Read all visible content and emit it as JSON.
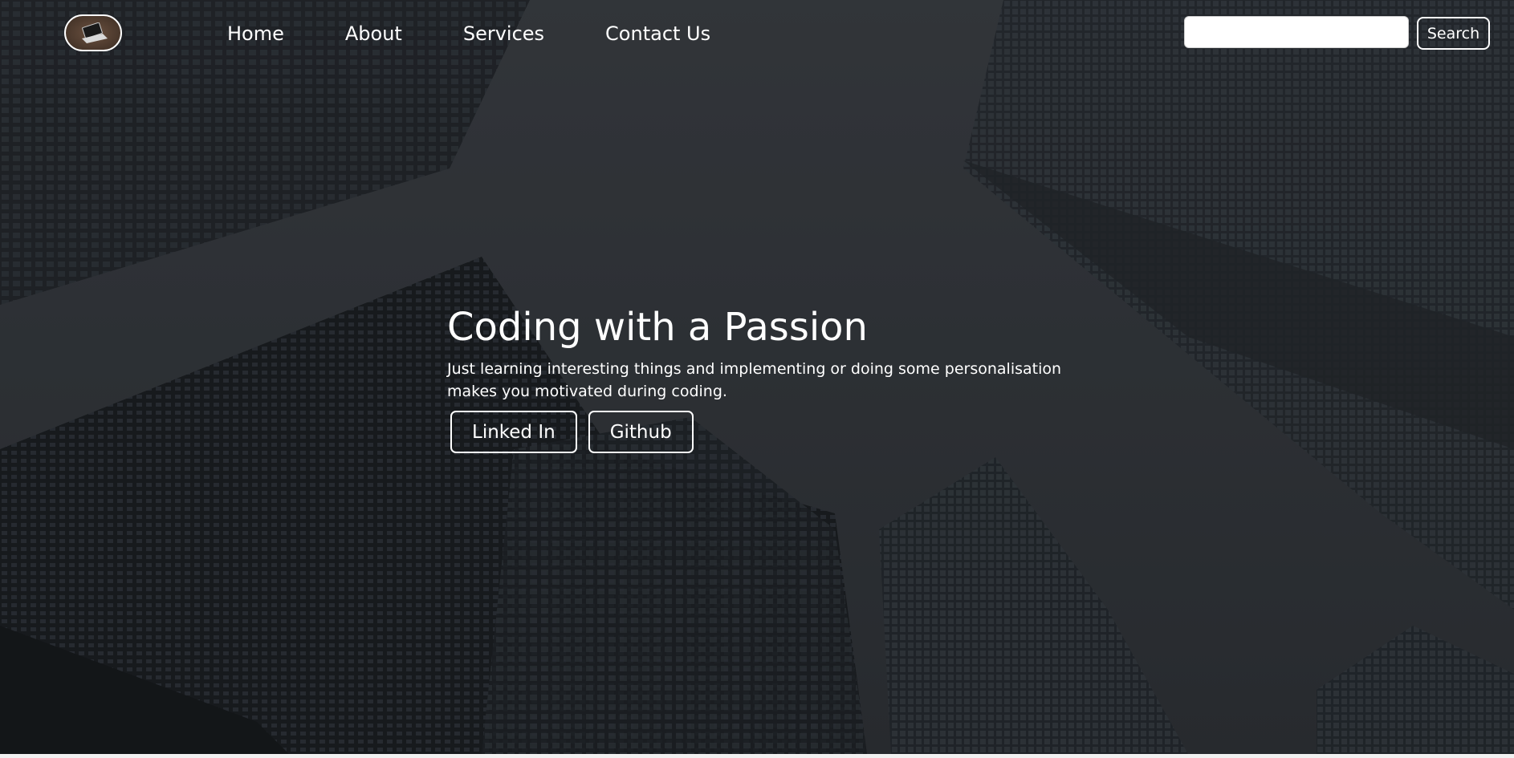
{
  "nav": {
    "logo_icon": "laptop-icon",
    "links": [
      {
        "label": "Home"
      },
      {
        "label": "About"
      },
      {
        "label": "Services"
      },
      {
        "label": "Contact Us"
      }
    ]
  },
  "search": {
    "value": "",
    "placeholder": "",
    "button_label": "Search"
  },
  "hero": {
    "title": "Coding with a Passion",
    "text": "Just learning interesting things and implementing or doing some personalisation makes you motivated during coding.",
    "buttons": [
      {
        "label": "Linked In"
      },
      {
        "label": "Github"
      }
    ]
  },
  "colors": {
    "text": "#ffffff",
    "background": "#35383d"
  }
}
